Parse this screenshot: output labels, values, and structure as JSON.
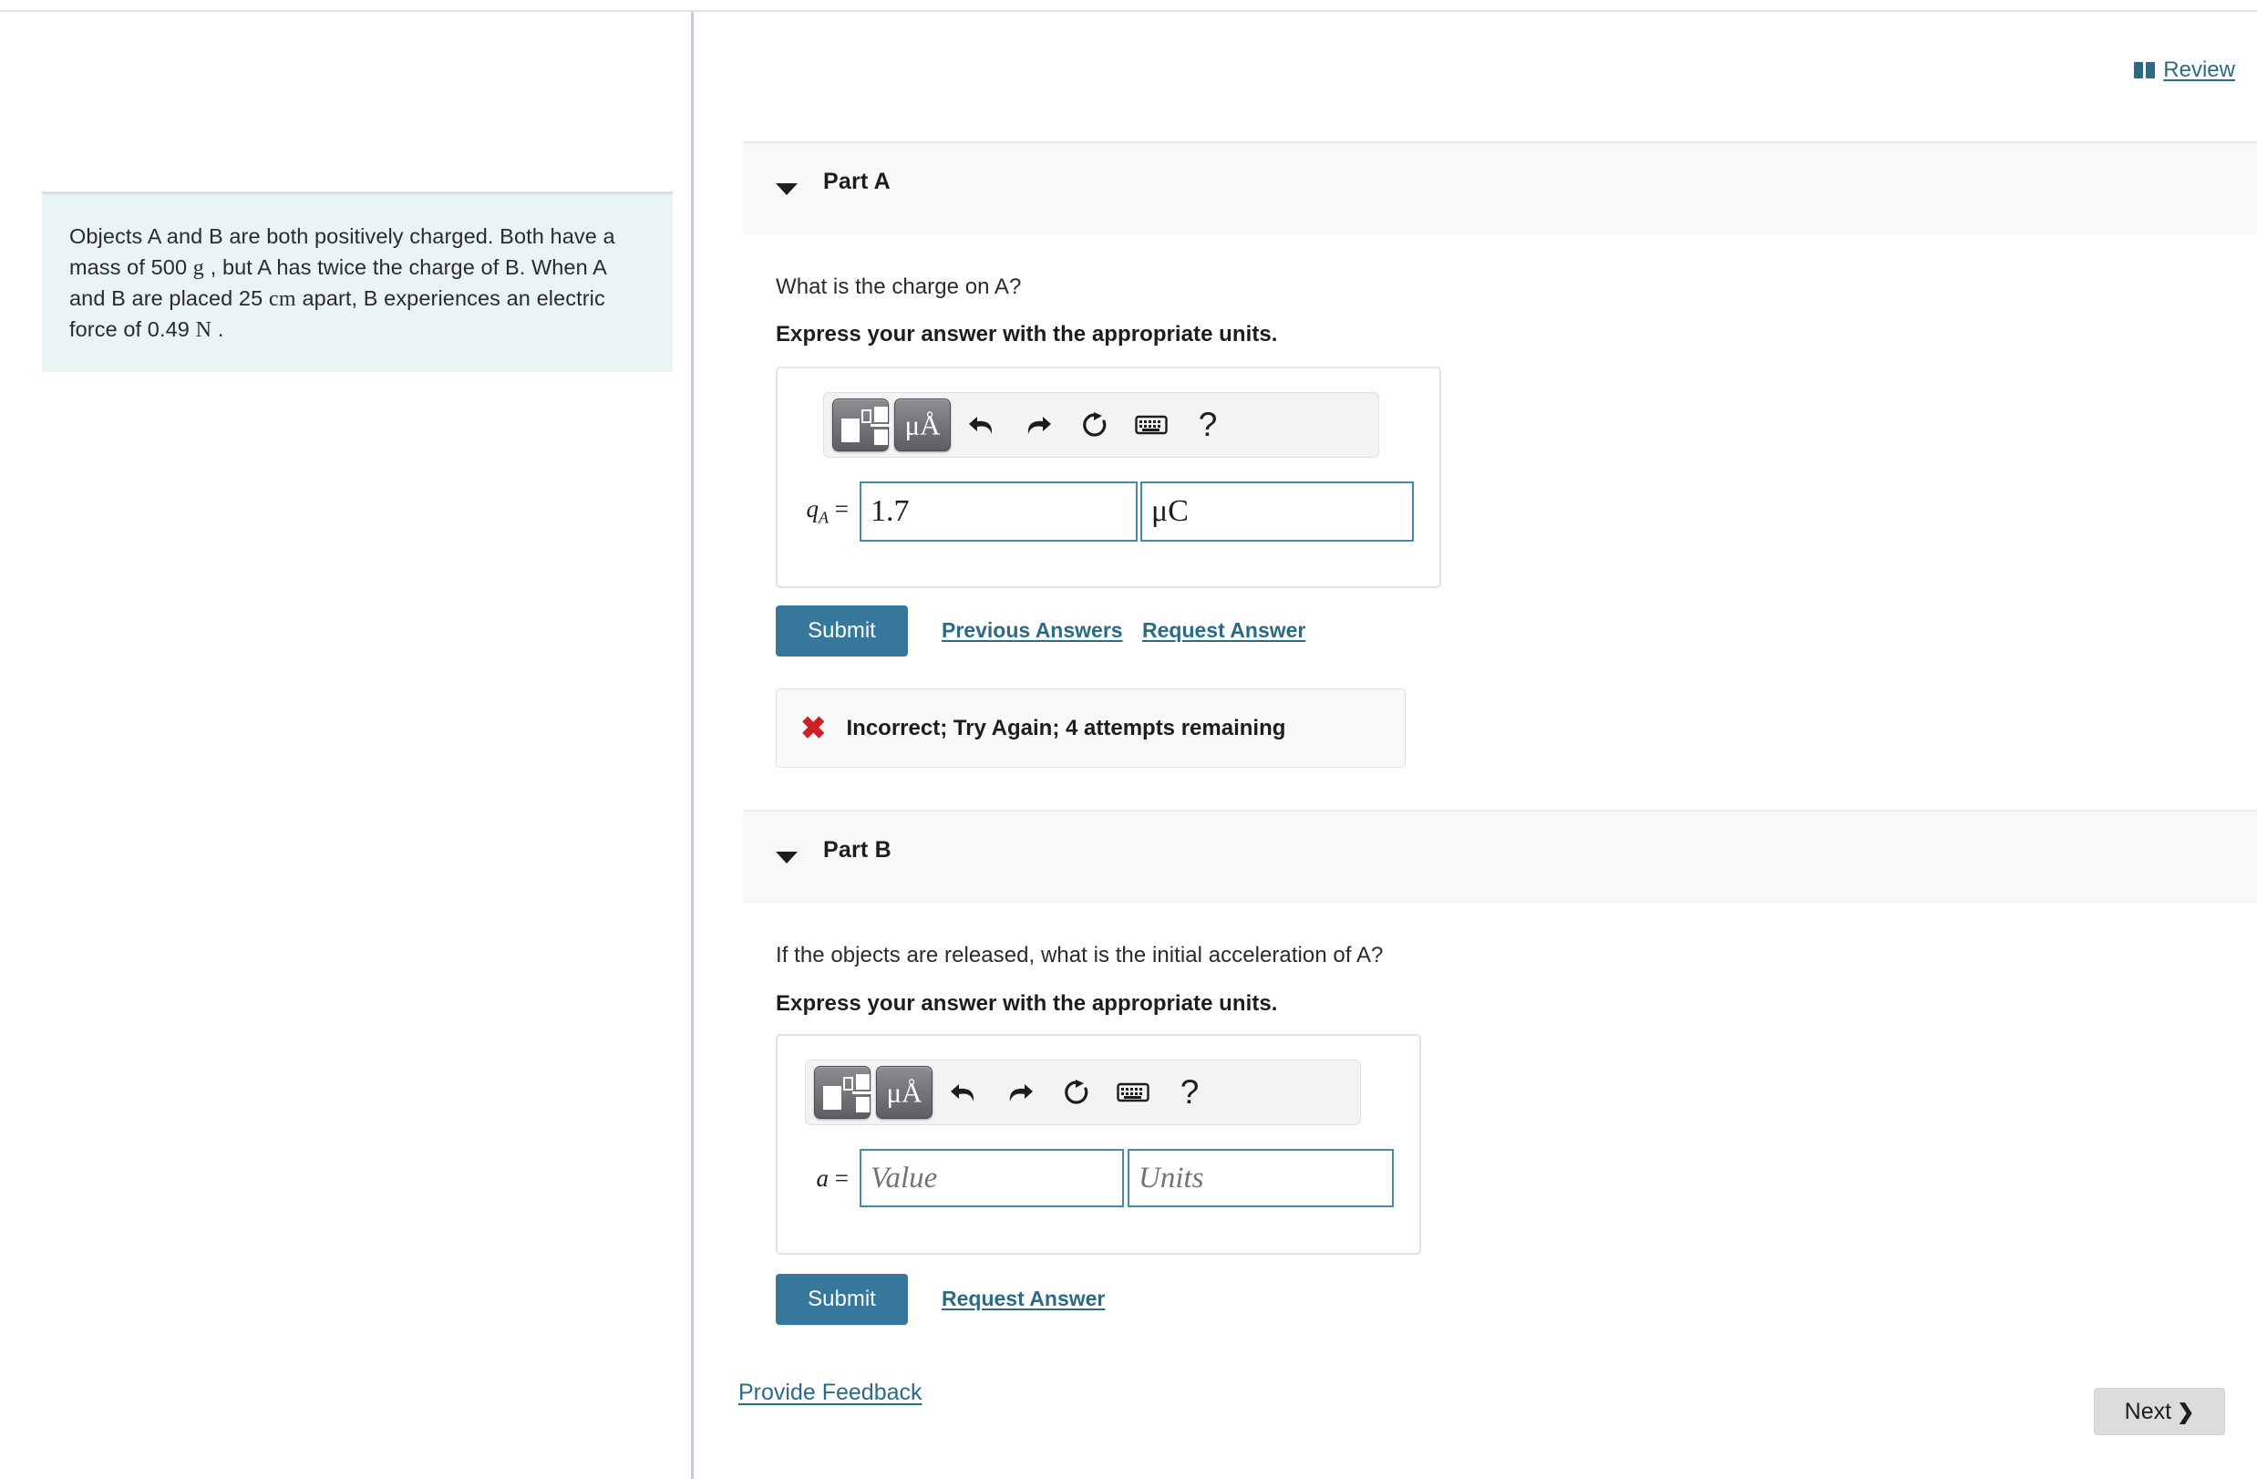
{
  "header": {
    "review_label": "Review",
    "book_icon": "open-book-icon"
  },
  "problem": {
    "text_part1": "Objects A and B are both positively charged. Both have a mass of 500 ",
    "unit_mass": "g",
    "text_part2": " , but A has twice the charge of B. When A and B are placed 25 ",
    "unit_distance": "cm",
    "text_part3": " apart, B experiences an electric force of 0.49 ",
    "unit_force": "N",
    "text_part4": " ."
  },
  "parts": [
    {
      "id": "part-a",
      "title": "Part A",
      "caret": "caret-down-icon",
      "question": "What is the charge on A?",
      "instruction": "Express your answer with the appropriate units.",
      "toolbar": {
        "template_button": "math-template-icon",
        "units_button": "μÅ",
        "undo": "undo-icon",
        "redo": "redo-icon",
        "reset": "reset-icon",
        "keyboard": "keyboard-icon",
        "help": "?"
      },
      "variable": "q",
      "variable_sub": "A",
      "equals": " =",
      "value": "1.7",
      "units": "μC",
      "value_placeholder": "Value",
      "units_placeholder": "Units",
      "submit_label": "Submit",
      "previous_answers_label": "Previous Answers",
      "request_answer_label": "Request Answer",
      "feedback": {
        "icon": "x-mark-icon",
        "message": "Incorrect; Try Again; 4 attempts remaining"
      }
    },
    {
      "id": "part-b",
      "title": "Part B",
      "caret": "caret-down-icon",
      "question": "If the objects are released, what is the initial acceleration of A?",
      "instruction": "Express your answer with the appropriate units.",
      "toolbar": {
        "template_button": "math-template-icon",
        "units_button": "μÅ",
        "undo": "undo-icon",
        "redo": "redo-icon",
        "reset": "reset-icon",
        "keyboard": "keyboard-icon",
        "help": "?"
      },
      "variable": "a",
      "equals": " =",
      "value": "",
      "units": "",
      "value_placeholder": "Value",
      "units_placeholder": "Units",
      "submit_label": "Submit",
      "request_answer_label": "Request Answer"
    }
  ],
  "footer": {
    "provide_feedback_label": "Provide Feedback",
    "next_label": "Next",
    "next_chevron": "chevron-right-icon"
  },
  "colors": {
    "accent_link": "#2b6b86",
    "submit_button": "#36789c",
    "field_border": "#4a88a5",
    "problem_panel": "#e9f4f4",
    "error_red": "#cf2027",
    "part_band": "#f8f8f8"
  }
}
